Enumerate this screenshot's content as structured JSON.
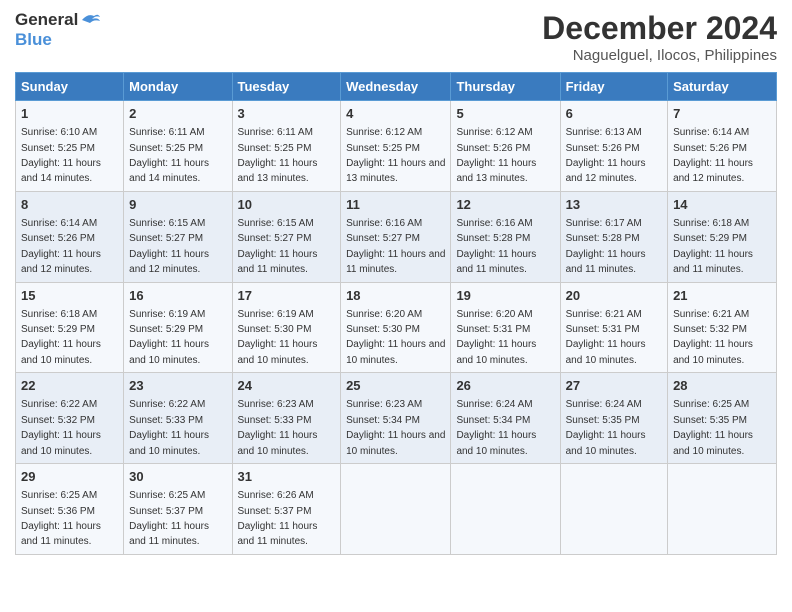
{
  "logo": {
    "line1": "General",
    "line2": "Blue"
  },
  "title": "December 2024",
  "location": "Naguelguel, Ilocos, Philippines",
  "weekdays": [
    "Sunday",
    "Monday",
    "Tuesday",
    "Wednesday",
    "Thursday",
    "Friday",
    "Saturday"
  ],
  "weeks": [
    [
      {
        "day": "1",
        "sunrise": "6:10 AM",
        "sunset": "5:25 PM",
        "daylight": "11 hours and 14 minutes."
      },
      {
        "day": "2",
        "sunrise": "6:11 AM",
        "sunset": "5:25 PM",
        "daylight": "11 hours and 14 minutes."
      },
      {
        "day": "3",
        "sunrise": "6:11 AM",
        "sunset": "5:25 PM",
        "daylight": "11 hours and 13 minutes."
      },
      {
        "day": "4",
        "sunrise": "6:12 AM",
        "sunset": "5:25 PM",
        "daylight": "11 hours and 13 minutes."
      },
      {
        "day": "5",
        "sunrise": "6:12 AM",
        "sunset": "5:26 PM",
        "daylight": "11 hours and 13 minutes."
      },
      {
        "day": "6",
        "sunrise": "6:13 AM",
        "sunset": "5:26 PM",
        "daylight": "11 hours and 12 minutes."
      },
      {
        "day": "7",
        "sunrise": "6:14 AM",
        "sunset": "5:26 PM",
        "daylight": "11 hours and 12 minutes."
      }
    ],
    [
      {
        "day": "8",
        "sunrise": "6:14 AM",
        "sunset": "5:26 PM",
        "daylight": "11 hours and 12 minutes."
      },
      {
        "day": "9",
        "sunrise": "6:15 AM",
        "sunset": "5:27 PM",
        "daylight": "11 hours and 12 minutes."
      },
      {
        "day": "10",
        "sunrise": "6:15 AM",
        "sunset": "5:27 PM",
        "daylight": "11 hours and 11 minutes."
      },
      {
        "day": "11",
        "sunrise": "6:16 AM",
        "sunset": "5:27 PM",
        "daylight": "11 hours and 11 minutes."
      },
      {
        "day": "12",
        "sunrise": "6:16 AM",
        "sunset": "5:28 PM",
        "daylight": "11 hours and 11 minutes."
      },
      {
        "day": "13",
        "sunrise": "6:17 AM",
        "sunset": "5:28 PM",
        "daylight": "11 hours and 11 minutes."
      },
      {
        "day": "14",
        "sunrise": "6:18 AM",
        "sunset": "5:29 PM",
        "daylight": "11 hours and 11 minutes."
      }
    ],
    [
      {
        "day": "15",
        "sunrise": "6:18 AM",
        "sunset": "5:29 PM",
        "daylight": "11 hours and 10 minutes."
      },
      {
        "day": "16",
        "sunrise": "6:19 AM",
        "sunset": "5:29 PM",
        "daylight": "11 hours and 10 minutes."
      },
      {
        "day": "17",
        "sunrise": "6:19 AM",
        "sunset": "5:30 PM",
        "daylight": "11 hours and 10 minutes."
      },
      {
        "day": "18",
        "sunrise": "6:20 AM",
        "sunset": "5:30 PM",
        "daylight": "11 hours and 10 minutes."
      },
      {
        "day": "19",
        "sunrise": "6:20 AM",
        "sunset": "5:31 PM",
        "daylight": "11 hours and 10 minutes."
      },
      {
        "day": "20",
        "sunrise": "6:21 AM",
        "sunset": "5:31 PM",
        "daylight": "11 hours and 10 minutes."
      },
      {
        "day": "21",
        "sunrise": "6:21 AM",
        "sunset": "5:32 PM",
        "daylight": "11 hours and 10 minutes."
      }
    ],
    [
      {
        "day": "22",
        "sunrise": "6:22 AM",
        "sunset": "5:32 PM",
        "daylight": "11 hours and 10 minutes."
      },
      {
        "day": "23",
        "sunrise": "6:22 AM",
        "sunset": "5:33 PM",
        "daylight": "11 hours and 10 minutes."
      },
      {
        "day": "24",
        "sunrise": "6:23 AM",
        "sunset": "5:33 PM",
        "daylight": "11 hours and 10 minutes."
      },
      {
        "day": "25",
        "sunrise": "6:23 AM",
        "sunset": "5:34 PM",
        "daylight": "11 hours and 10 minutes."
      },
      {
        "day": "26",
        "sunrise": "6:24 AM",
        "sunset": "5:34 PM",
        "daylight": "11 hours and 10 minutes."
      },
      {
        "day": "27",
        "sunrise": "6:24 AM",
        "sunset": "5:35 PM",
        "daylight": "11 hours and 10 minutes."
      },
      {
        "day": "28",
        "sunrise": "6:25 AM",
        "sunset": "5:35 PM",
        "daylight": "11 hours and 10 minutes."
      }
    ],
    [
      {
        "day": "29",
        "sunrise": "6:25 AM",
        "sunset": "5:36 PM",
        "daylight": "11 hours and 11 minutes."
      },
      {
        "day": "30",
        "sunrise": "6:25 AM",
        "sunset": "5:37 PM",
        "daylight": "11 hours and 11 minutes."
      },
      {
        "day": "31",
        "sunrise": "6:26 AM",
        "sunset": "5:37 PM",
        "daylight": "11 hours and 11 minutes."
      },
      null,
      null,
      null,
      null
    ]
  ],
  "labels": {
    "sunrise": "Sunrise:",
    "sunset": "Sunset:",
    "daylight": "Daylight:"
  }
}
